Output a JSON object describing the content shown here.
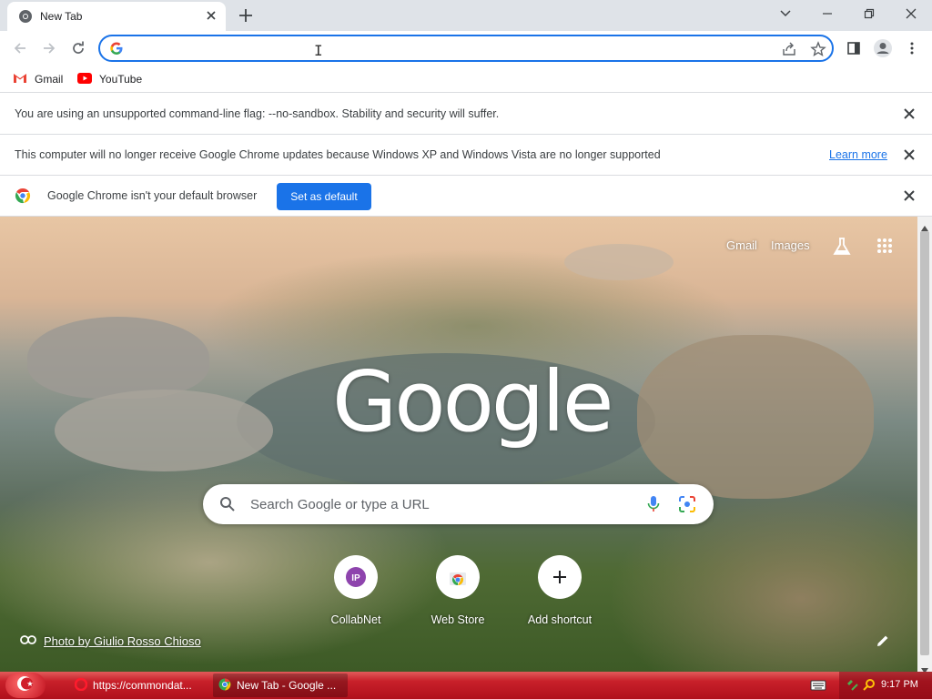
{
  "window": {
    "tab_title": "New Tab"
  },
  "toolbar": {
    "omnibox_value": ""
  },
  "bookmarks": [
    {
      "label": "Gmail"
    },
    {
      "label": "YouTube"
    }
  ],
  "infobars": {
    "sandbox_msg": "You are using an unsupported command-line flag: --no-sandbox. Stability and security will suffer.",
    "updates_msg": "This computer will no longer receive Google Chrome updates because Windows XP and Windows Vista are no longer supported",
    "learn_more": "Learn more",
    "default_msg": "Google Chrome isn't your default browser",
    "set_default": "Set as default"
  },
  "ntp": {
    "gmail": "Gmail",
    "images": "Images",
    "logo": "Google",
    "search_placeholder": "Search Google or type a URL",
    "shortcuts": [
      {
        "label": "CollabNet",
        "icon": "collabnet-icon"
      },
      {
        "label": "Web Store",
        "icon": "web-store-icon"
      },
      {
        "label": "Add shortcut",
        "icon": "plus-icon"
      }
    ],
    "photo_credit": "Photo by Giulio Rosso Chioso"
  },
  "taskbar": {
    "items": [
      {
        "label": "https://commondat..."
      },
      {
        "label": "New Tab - Google ..."
      }
    ],
    "clock": "9:17 PM"
  },
  "colors": {
    "accent": "#1a73e8",
    "taskbar": "#c8202a"
  }
}
